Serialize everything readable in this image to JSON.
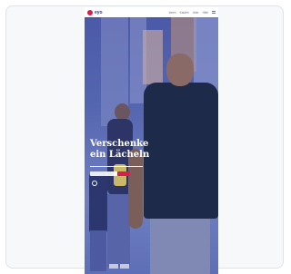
{
  "header": {
    "logo_text": "eyo",
    "nav_items": [
      "Ideen",
      "Kaufen",
      "Uber",
      "Hilfe"
    ]
  },
  "hero": {
    "title_line1": "Verschenke",
    "title_line2": "ein Lächeln"
  },
  "colors": {
    "brand": "#d61f4b",
    "overlay": "#3e4a9e"
  },
  "icons": {
    "menu": "menu-icon",
    "logo": "logo-mark-icon",
    "info": "info-icon"
  }
}
